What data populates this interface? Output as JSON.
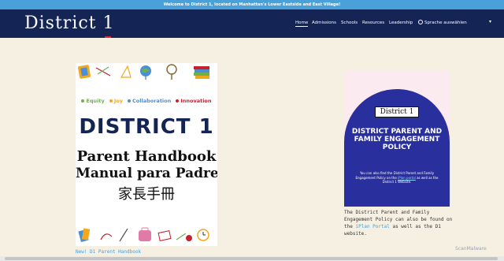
{
  "announcement": "Welcome to District 1, located on Manhattan's Lower Eastside and East Village!",
  "logo_text": "District 1",
  "nav": {
    "items": [
      "Home",
      "Admissions",
      "Schools",
      "Resources",
      "Leadership"
    ],
    "language": "Sprache auswählen"
  },
  "handbook": {
    "values": [
      "Equity",
      "Joy",
      "Collaboration",
      "Innovation"
    ],
    "value_colors": [
      "#6cb24a",
      "#f2a81d",
      "#4a8fd8",
      "#c8202c"
    ],
    "logo": "DISTRICT 1",
    "title_en": "Parent Handbook",
    "title_es": "Manual para Padres",
    "title_zh": "家長手冊",
    "link": "New! D1 Parent Handbook"
  },
  "policy": {
    "logo": "District 1",
    "title": "DISTRICT PARENT AND FAMILY ENGAGEMENT POLICY",
    "small_text_before": "You can also find the District Parent and Family Engagement Policy on the",
    "small_link": "iPlan portal",
    "small_text_after": "as well as the District 1 Website.",
    "text_before": "The District Parent and Family Engagement Policy can also be found on the",
    "text_link": "iPlan Portal",
    "text_after": "as well as the D1 website."
  },
  "watermark": "ScanMalware",
  "colors": {
    "header_bg": "#142454",
    "announcement_bg": "#4aa0d8",
    "page_bg": "#f6f0e2",
    "accent_red": "#d8283c"
  }
}
